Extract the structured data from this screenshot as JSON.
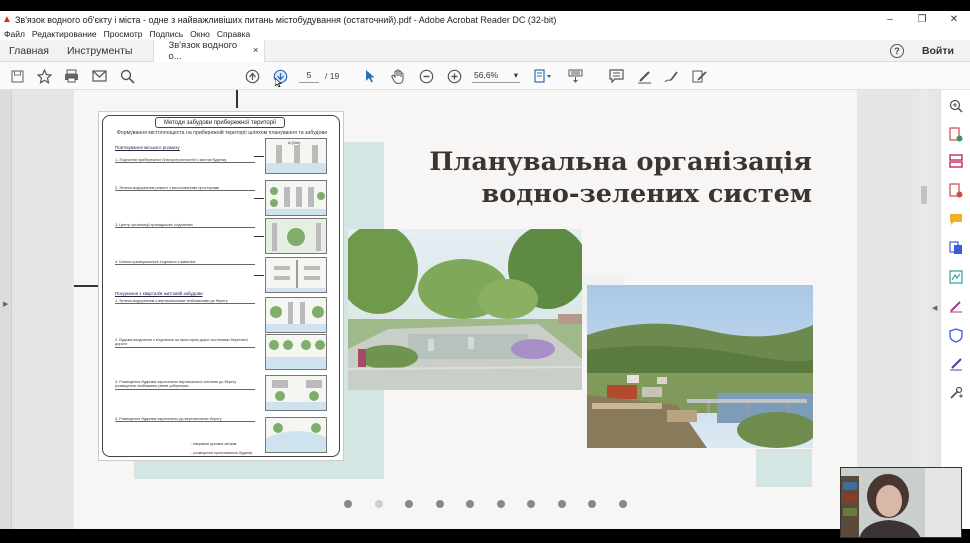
{
  "window": {
    "title": "Зв'язок водного об'єкту і міста - одне з найважливіших питань містобудування (остаточний).pdf - Adobe Acrobat Reader DC (32-bit)",
    "minimize": "–",
    "maximize": "❐",
    "close": "✕"
  },
  "menu": [
    "Файл",
    "Редактирование",
    "Просмотр",
    "Подпись",
    "Окно",
    "Справка"
  ],
  "tabs": {
    "home": "Главная",
    "tools": "Инструменты",
    "document": "Зв'язок водного о...",
    "close": "×",
    "help": "?",
    "signin": "Войти"
  },
  "toolbar": {
    "page_current": "5",
    "page_total": "/ 19",
    "zoom": "56,6%",
    "zoom_caret": "▾"
  },
  "slide": {
    "heading_line1": "Планувальна організація",
    "heading_line2": "водно-зелених систем",
    "schema": {
      "title": "Методи забудови прибережної території",
      "subtitle": "Формування містоплощеста на прибережній території шляхом планування та забудови",
      "section1": "Пов'язування міського розмоху",
      "items1": [
        "1. З'єднання прибережних благоустроєностей з містом будинку",
        "2. Зелено-водорезним ремонт з висосованими просторами",
        "3. Центр організації громадських з'єднаннях",
        "4. Шляхи-пряморикальні з'єднання з акватією"
      ],
      "section2": "Поєднання з кварталів житловій забудови",
      "items2": [
        "1. Зелено-водорезним з вертикальними лінійованими до берегу",
        "2. Будова-поєднання з в'єднаною за простором дорої системами берегової дороги",
        "3. Розміщення будинків паралельно вертикальної системи до берегу розміщення лінійованих рівнів узбережжя",
        "4. Розміщення будинків паралельно до вертикальних берегу"
      ],
      "legend1": "- напрямок рухових зв'язків",
      "legend2": "- розміщення проектованого будинку",
      "diagram_label": "A (Nm)"
    },
    "pagination": {
      "count": 10,
      "active_index": 1
    }
  },
  "colors": {
    "accent_teal": "#d4e6e3",
    "heading": "#3b3431",
    "acrobat_red": "#d32f2f"
  }
}
